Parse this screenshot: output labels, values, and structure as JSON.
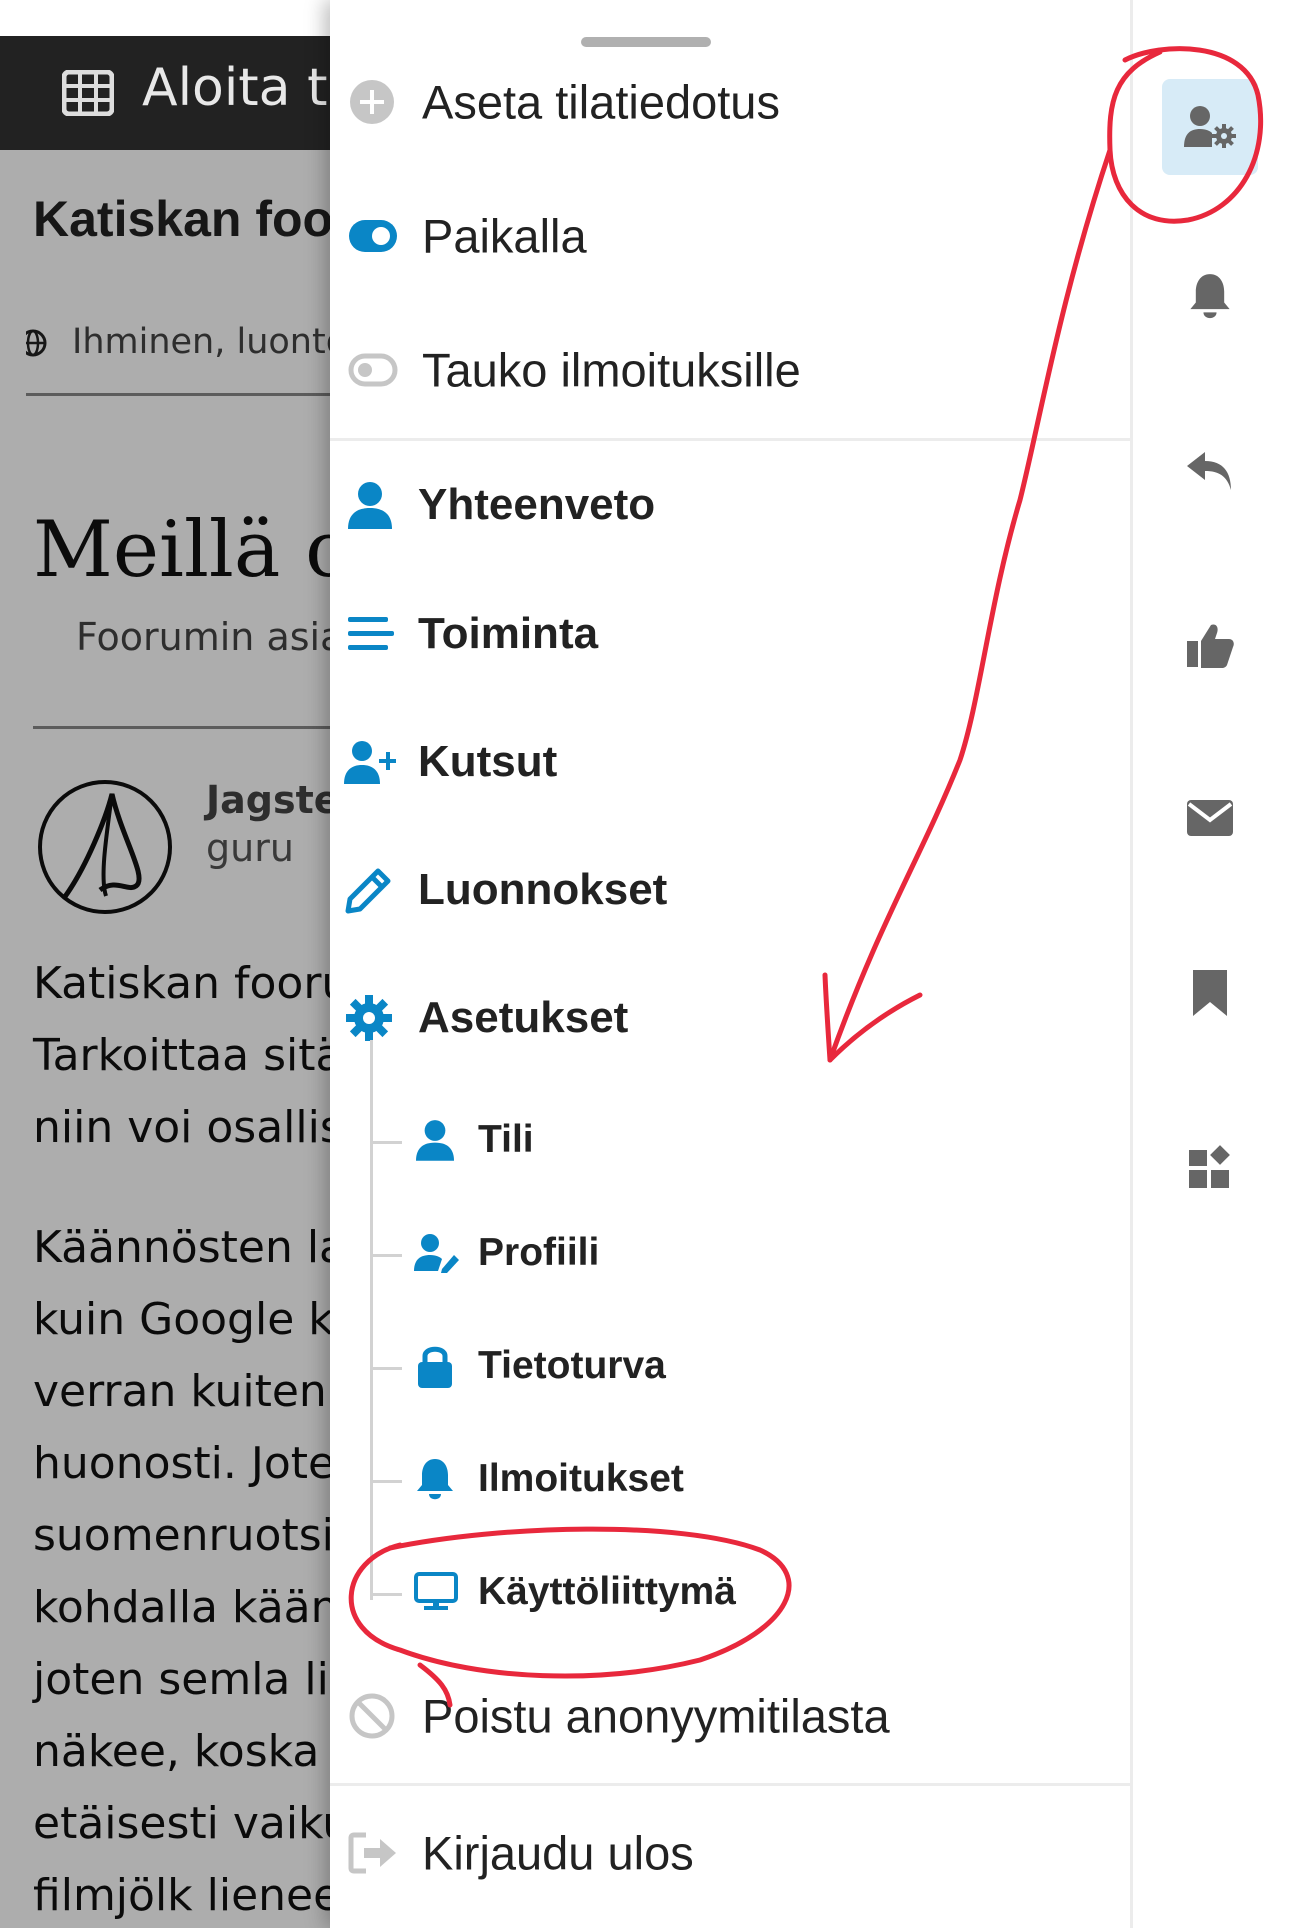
{
  "background": {
    "topbar_title": "Aloita tä",
    "category_title": "Katiskan foo",
    "tags_text": "Ihminen, luonto",
    "hero_title": "Meillä on",
    "subtitle": "Foorumin asia",
    "author_name": "Jagste",
    "author_role": "guru",
    "paragraph1": [
      "Katiskan fooru",
      "Tarkoittaa sitä",
      "niin voi osallis"
    ],
    "paragraph2": [
      "Käännösten la",
      "kuin Google kä",
      "verran kuitenk",
      "huonosti. Jote",
      "suomenruotsi",
      "kohdalla kään",
      "joten semla lie",
      "näkee, koska k",
      "etäisesti vaiku",
      "filmjölk lienee"
    ]
  },
  "menu": {
    "status": [
      {
        "label": "Aseta tilatiedotus",
        "icon": "plus-circle-icon"
      },
      {
        "label": "Paikalla",
        "icon": "toggle-on-icon"
      },
      {
        "label": "Tauko ilmoituksille",
        "icon": "toggle-off-icon"
      }
    ],
    "main": [
      {
        "label": "Yhteenveto",
        "icon": "user-icon"
      },
      {
        "label": "Toiminta",
        "icon": "lines-icon"
      },
      {
        "label": "Kutsut",
        "icon": "user-plus-icon"
      },
      {
        "label": "Luonnokset",
        "icon": "pencil-icon"
      },
      {
        "label": "Asetukset",
        "icon": "gear-icon"
      }
    ],
    "settings_sub": [
      {
        "label": "Tili",
        "icon": "user-icon"
      },
      {
        "label": "Profiili",
        "icon": "user-pen-icon"
      },
      {
        "label": "Tietoturva",
        "icon": "lock-icon"
      },
      {
        "label": "Ilmoitukset",
        "icon": "bell-icon"
      },
      {
        "label": "Käyttöliittymä",
        "icon": "monitor-icon"
      }
    ],
    "anonymous": {
      "label": "Poistu anonyymitilasta",
      "icon": "ban-icon"
    },
    "logout": {
      "label": "Kirjaudu ulos",
      "icon": "sign-out-icon"
    }
  },
  "rail": [
    "user-gear-icon",
    "bell-icon",
    "reply-icon",
    "thumbs-up-icon",
    "envelope-icon",
    "bookmark-icon",
    "widgets-icon"
  ],
  "colors": {
    "accent": "#0a86c6",
    "annotation": "#e8283c",
    "muted_icon": "#666666",
    "topbar": "#222222"
  }
}
